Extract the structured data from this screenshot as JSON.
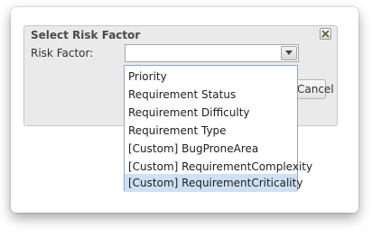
{
  "dialog": {
    "title": "Select Risk Factor",
    "field_label": "Risk Factor:",
    "selected_value": "",
    "cancel_label": "Cancel",
    "close_icon": "close-icon"
  },
  "dropdown": {
    "options": [
      "Priority",
      "Requirement Status",
      "Requirement Difficulty",
      "Requirement Type",
      "[Custom] BugProneArea",
      "[Custom] RequirementComplexity",
      "[Custom] RequirementCriticality"
    ],
    "highlighted_option": "[Custom] RequirementCriticality"
  },
  "colors": {
    "highlight": "#cfe0f5",
    "dialog_background": "#eaeaea"
  }
}
